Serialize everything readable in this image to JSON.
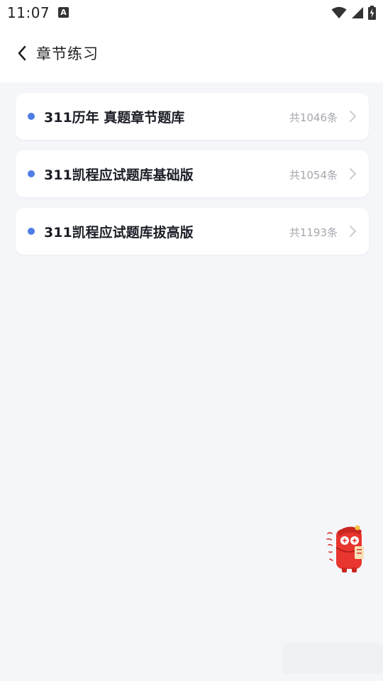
{
  "status_bar": {
    "time": "11:07",
    "notification_icon_glyph": "A",
    "icons": [
      "wifi-icon",
      "signal-icon",
      "battery-charging-icon"
    ]
  },
  "header": {
    "back_icon": "chevron-left-icon",
    "title": "章节练习"
  },
  "chapters": [
    {
      "title": "311历年 真题章节题库",
      "count": "共1046条"
    },
    {
      "title": "311凯程应试题库基础版",
      "count": "共1054条"
    },
    {
      "title": "311凯程应试题库拔高版",
      "count": "共1193条"
    }
  ],
  "mascot": {
    "icon": "red-envelope-mascot-icon"
  },
  "colors": {
    "accent_dot": "#4f7de5",
    "background": "#f5f6fa",
    "card": "#ffffff",
    "count_text": "#a4a7ae",
    "mascot_red": "#e8352e"
  }
}
